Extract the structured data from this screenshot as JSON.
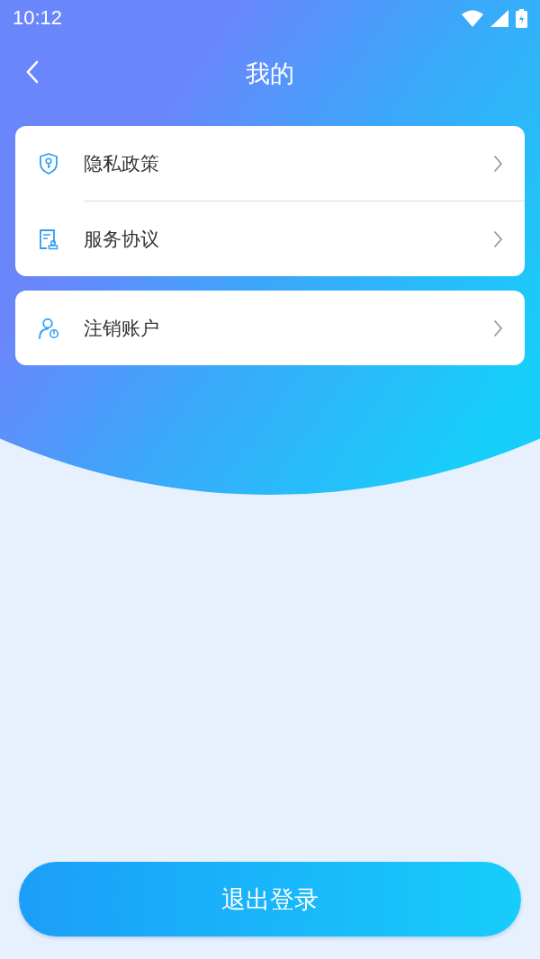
{
  "status_bar": {
    "time": "10:12"
  },
  "header": {
    "title": "我的"
  },
  "groups": [
    {
      "items": [
        {
          "kind": "shield",
          "label": "隐私政策"
        },
        {
          "kind": "document",
          "label": "服务协议"
        }
      ]
    },
    {
      "items": [
        {
          "kind": "user",
          "label": "注销账户"
        }
      ]
    }
  ],
  "logout_button": {
    "label": "退出登录"
  }
}
